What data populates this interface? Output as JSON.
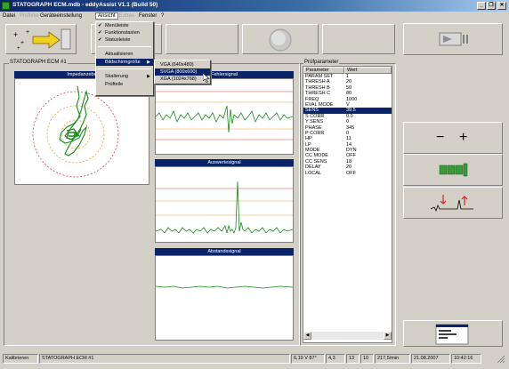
{
  "window": {
    "title": "STATOGRAPH ECM.mdb - eddyAssist V1.1 (Build 50)",
    "minimize": "_",
    "maximize": "❐",
    "close": "✕"
  },
  "menu": {
    "items": [
      "Datei",
      "Prüflinie",
      "Geräteeinstellung",
      "Ansicht",
      "Extras",
      "Fenster",
      "?"
    ]
  },
  "ansicht_menu": {
    "items": [
      {
        "label": "Menüleiste",
        "checked": true
      },
      {
        "label": "Funktionstasten",
        "checked": true
      },
      {
        "label": "Statusleiste",
        "checked": true
      },
      {
        "label": "Aktualisieren",
        "checked": false
      },
      {
        "label": "Bildschirmgröße",
        "checked": false,
        "submenu": true
      },
      {
        "label": "Skalierung",
        "checked": false,
        "submenu": true
      },
      {
        "label": "Prüfteile",
        "checked": false
      }
    ]
  },
  "screen_size_submenu": {
    "items": [
      "VGA (640x480)",
      "SVGA (800x600)",
      "XGA (1024x768)"
    ],
    "selected_index": 1
  },
  "instrument": {
    "group_label": "STATOGRAPH ECM #1",
    "impedance_title": "Impedanzebe",
    "fehler_title": "Fehlersignal",
    "auswerte_title": "Auswertesignal",
    "abstand_title": "Abstandssignal"
  },
  "parameters": {
    "group_label": "Prüfparameter",
    "col_param": "Parameter",
    "col_value": "Wert",
    "rows": [
      [
        "PARAM SET",
        "1"
      ],
      [
        "THRESH A",
        "20"
      ],
      [
        "THRESH B",
        "50"
      ],
      [
        "THRESH C",
        "80"
      ],
      [
        "FREQ",
        "1000"
      ],
      [
        "EVAL MODE",
        "V"
      ],
      [
        "SENS",
        "39.5"
      ],
      [
        "S CORR",
        "0.0"
      ],
      [
        "Y SENS",
        "0"
      ],
      [
        "PHASE",
        "345"
      ],
      [
        "P CORR",
        "0"
      ],
      [
        "HP",
        "11"
      ],
      [
        "LP",
        "14"
      ],
      [
        "MODE",
        "DYN"
      ],
      [
        "CC MODE",
        "OFF"
      ],
      [
        "CC SENS",
        "18"
      ],
      [
        "DELAY",
        "20"
      ],
      [
        "LOCAL",
        "OFF"
      ]
    ],
    "selected_row": 6
  },
  "right_panel": {
    "zoom_minus": "−",
    "zoom_plus": "+"
  },
  "status": {
    "mode": "Kalibrieren",
    "device": "STATOGRAPH ECM #1",
    "voltage": "6,19 V 87°",
    "v1": "4,3",
    "v2": "13",
    "v3": "10",
    "speed": "217,5/min",
    "date": "21.08.2007",
    "time": "10:42:16"
  },
  "colors": {
    "header_blue": "#0a246a",
    "signal_green": "#1a8a1a",
    "threshold_red": "#e04040",
    "threshold_orange": "#f0a030"
  }
}
